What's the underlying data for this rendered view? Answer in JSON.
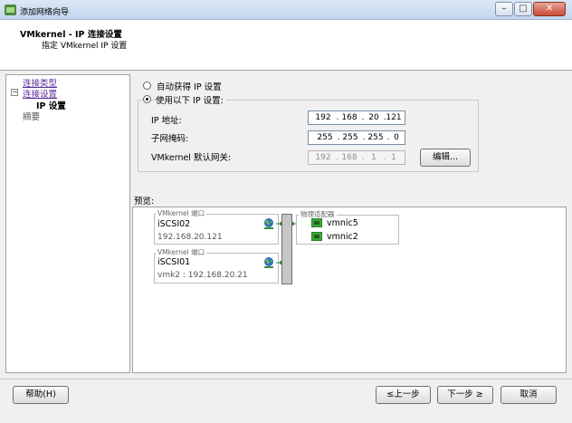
{
  "window": {
    "title": "添加网络向导",
    "controls": {
      "minimize": "–",
      "maximize": "□",
      "close": "✕"
    }
  },
  "header": {
    "title": "VMkernel - IP 连接设置",
    "subtitle": "指定 VMkernel IP 设置"
  },
  "nav": {
    "items": [
      {
        "label": "连接类型",
        "style": "link"
      },
      {
        "label": "连接设置",
        "style": "link",
        "expander": "⊟"
      },
      {
        "label": "IP 设置",
        "style": "current"
      },
      {
        "label": "摘要",
        "style": "plain"
      }
    ]
  },
  "ip_settings": {
    "option_auto": "自动获得 IP 设置",
    "option_manual": "使用以下 IP 设置:",
    "selected": "manual",
    "ip_label": "IP 地址:",
    "ip": [
      "192",
      "168",
      "20",
      "121"
    ],
    "mask_label": "子网掩码:",
    "mask": [
      "255",
      "255",
      "255",
      "0"
    ],
    "gateway_label": "VMkernel 默认网关:",
    "gateway": [
      "192",
      "168",
      "1",
      "1"
    ],
    "edit_button": "编辑..."
  },
  "preview": {
    "label": "预览:",
    "port_groups": [
      {
        "caption": "VMkernel 端口",
        "name": "iSCSI02",
        "detail": "192.168.20.121"
      },
      {
        "caption": "VMkernel 端口",
        "name": "iSCSI01",
        "detail": "vmk2 : 192.168.20.21"
      }
    ],
    "adapters_caption": "物理适配器",
    "adapters": [
      "vmnic5",
      "vmnic2"
    ]
  },
  "footer": {
    "help": "帮助(H)",
    "back": "≤上一步",
    "next": "下一步 ≥",
    "cancel": "取消"
  },
  "colors": {
    "link": "#5a2d9a",
    "nic_green": "#3aa63a",
    "connector_green": "#2e8b2e",
    "globe_blue": "#2f6fc0"
  }
}
